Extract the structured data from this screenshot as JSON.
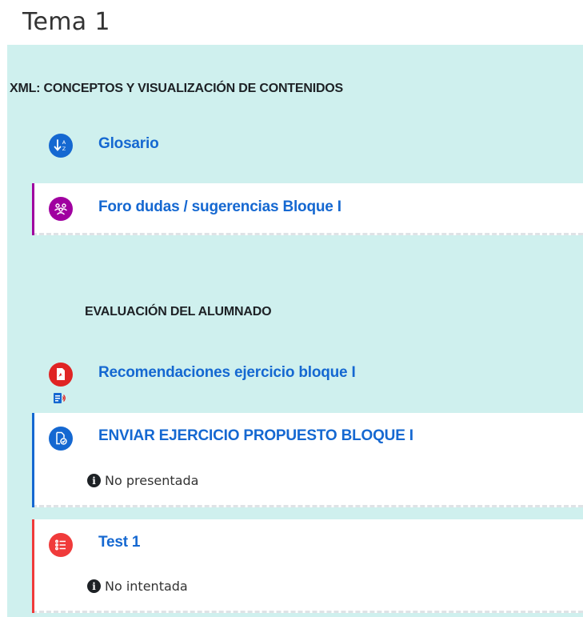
{
  "page": {
    "title": "Tema 1"
  },
  "section": {
    "heading": "XML: CONCEPTOS Y VISUALIZACIÓN DE CONTENIDOS",
    "subheading": "EVALUACIÓN DEL ALUMNADO"
  },
  "activities": [
    {
      "name": "Glosario",
      "type": "glossary",
      "icon": "glossary-icon",
      "color": "#1568d1"
    },
    {
      "name": "Foro dudas / sugerencias Bloque I",
      "type": "forum",
      "icon": "forum-icon",
      "color": "#a000a0"
    },
    {
      "name": "Recomendaciones ejercicio bloque I",
      "type": "pdf-resource",
      "icon": "pdf-icon",
      "color": "#e02424"
    },
    {
      "name": "ENVIAR EJERCICIO PROPUESTO BLOQUE I",
      "type": "assignment",
      "icon": "assignment-icon",
      "color": "#1568d1",
      "status": "No presentada"
    },
    {
      "name": "Test 1",
      "type": "quiz",
      "icon": "quiz-icon",
      "color": "#f03b3b",
      "status": "No intentada"
    }
  ],
  "colors": {
    "section_bg": "#cff0ee",
    "link": "#1568d1",
    "forum_accent": "#a000a0",
    "assignment_accent": "#1568d1",
    "quiz_accent": "#f03b3b"
  }
}
